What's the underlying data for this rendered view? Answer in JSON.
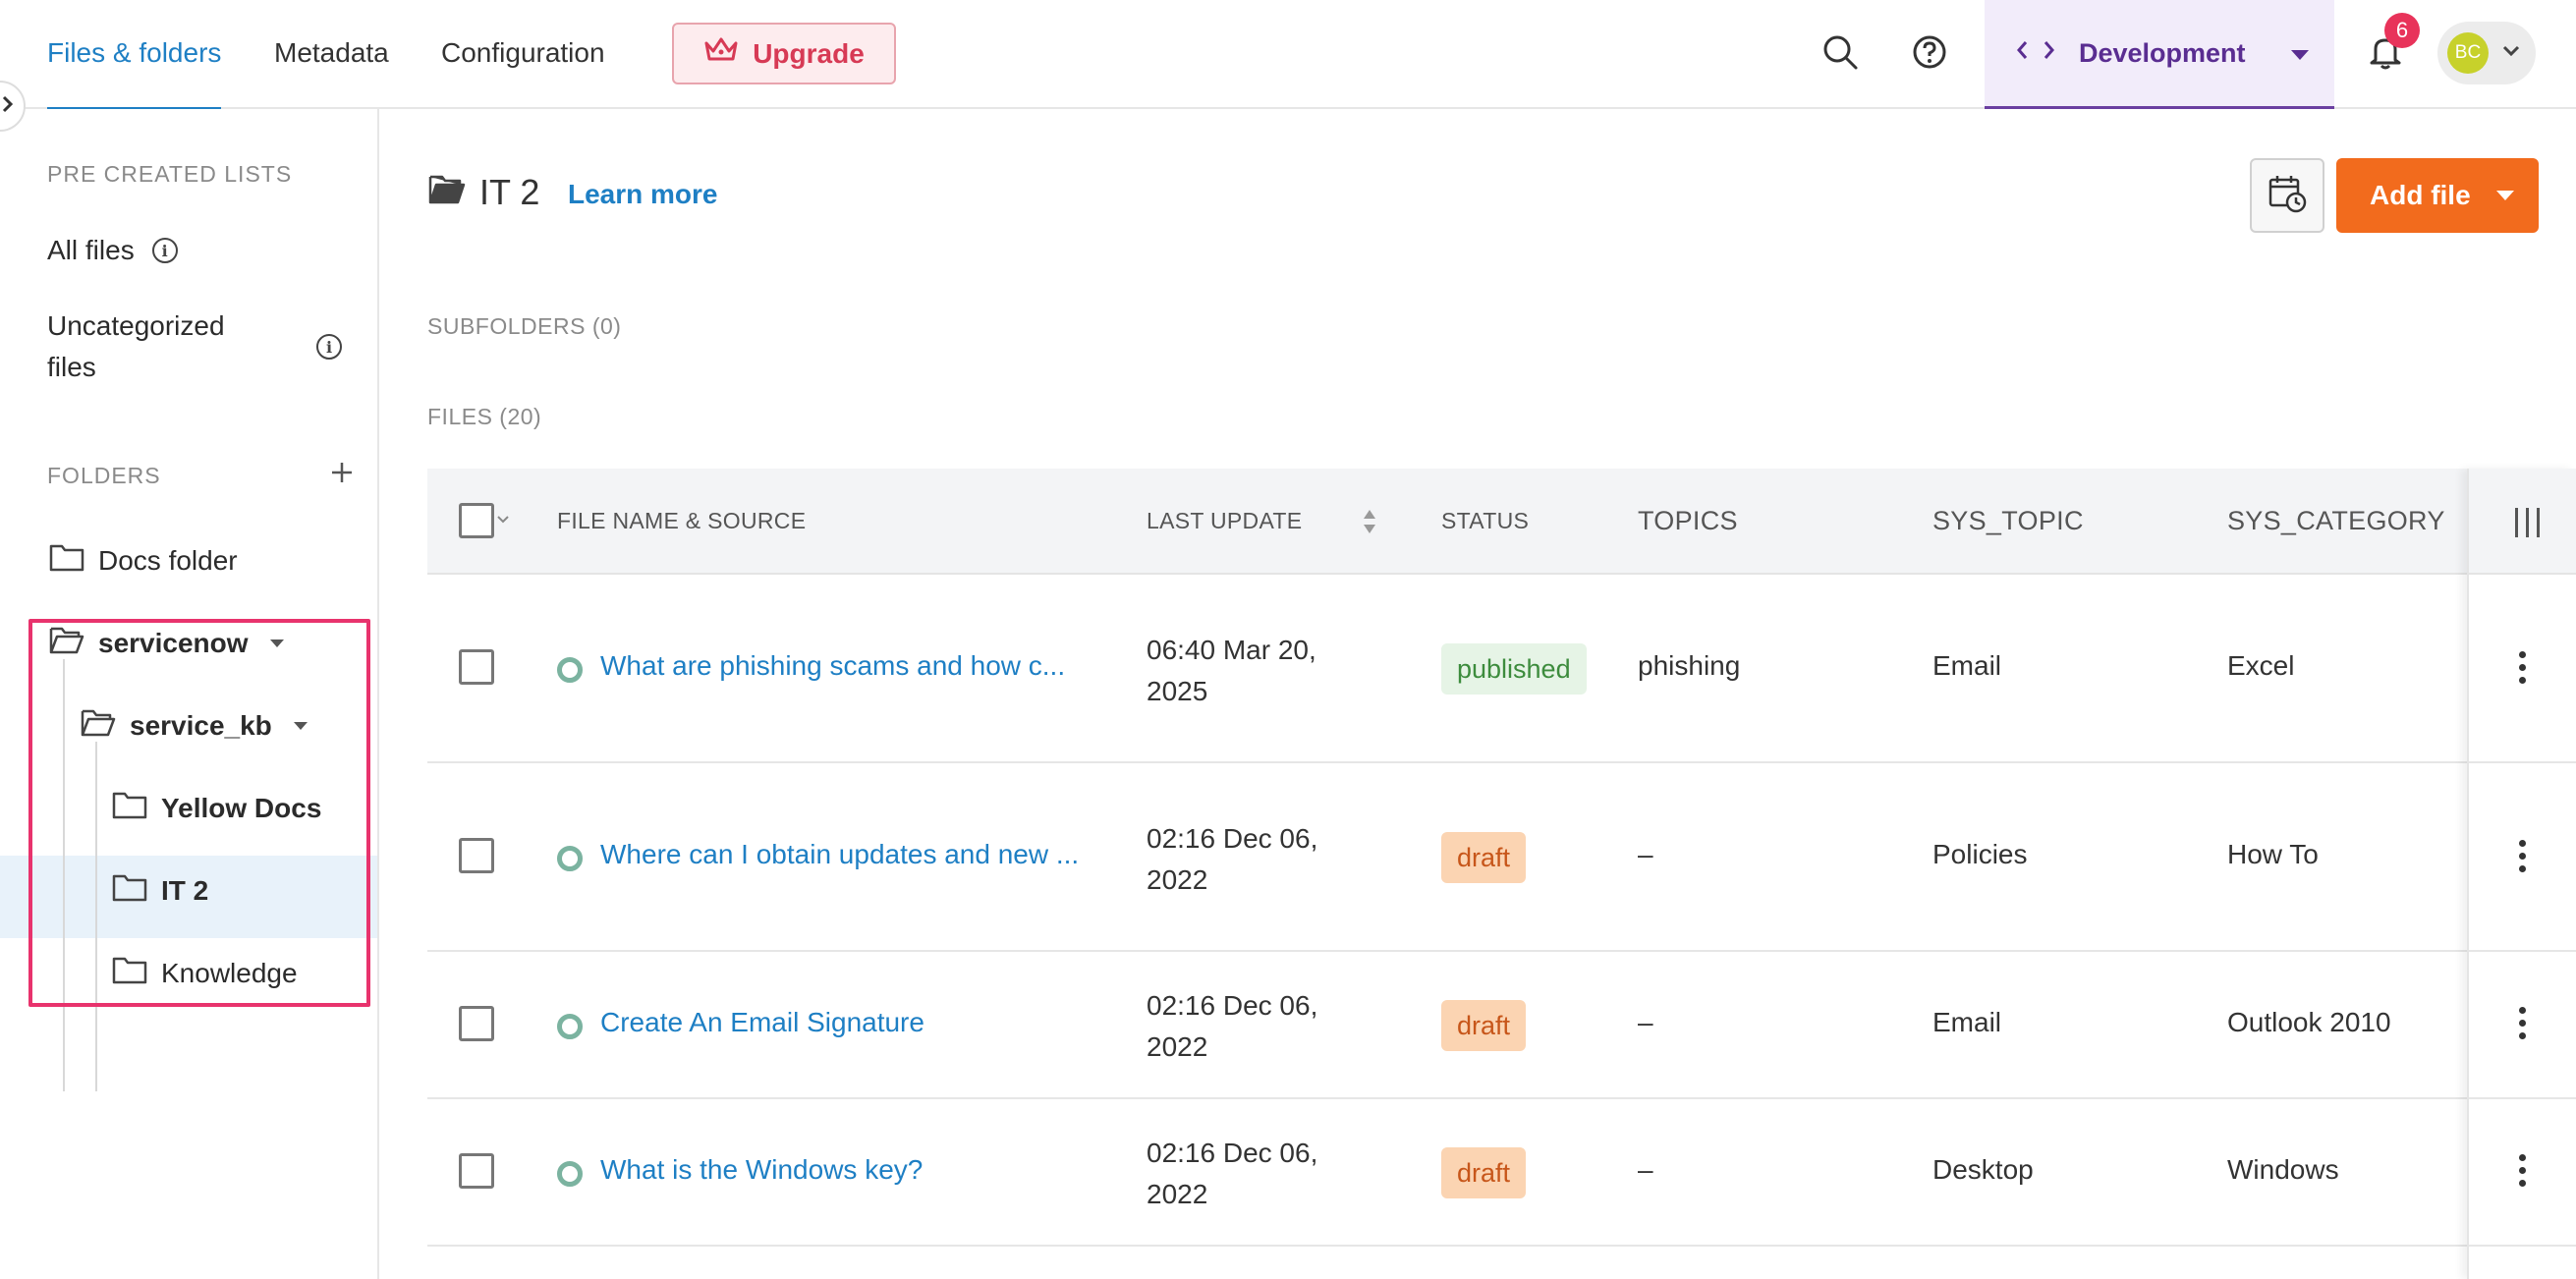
{
  "nav": {
    "tabs": [
      {
        "label": "Files & folders",
        "active": true
      },
      {
        "label": "Metadata",
        "active": false
      },
      {
        "label": "Configuration",
        "active": false
      }
    ],
    "upgrade_label": "Upgrade",
    "environment_label": "Development",
    "notification_count": "6",
    "avatar_initials": "BC"
  },
  "sidebar": {
    "precreated_heading": "PRE CREATED LISTS",
    "all_files_label": "All files",
    "uncategorized_line1": "Uncategorized",
    "uncategorized_line2": "files",
    "folders_heading": "FOLDERS",
    "folders": {
      "docs_folder": "Docs folder",
      "servicenow": "servicenow",
      "service_kb": "service_kb",
      "yellow_docs": "Yellow Docs",
      "it2": "IT 2",
      "knowledge": "Knowledge"
    }
  },
  "main": {
    "folder_title": "IT 2",
    "learn_more": "Learn more",
    "add_file_label": "Add file",
    "subfolders_label": "SUBFOLDERS (0)",
    "files_label": "FILES (20)",
    "columns": {
      "file_name": "FILE NAME & SOURCE",
      "last_update": "LAST UPDATE",
      "status": "STATUS",
      "topics": "TOPICS",
      "sys_topic": "SYS_TOPIC",
      "sys_category": "SYS_CATEGORY"
    },
    "rows": [
      {
        "name": "What are phishing scams and how c...",
        "date_line1": "06:40 Mar 20,",
        "date_line2": "2025",
        "status": "published",
        "topics": "phishing",
        "sys_topic": "Email",
        "sys_category": "Excel"
      },
      {
        "name": "Where can I obtain updates and new ...",
        "date_line1": "02:16 Dec 06,",
        "date_line2": "2022",
        "status": "draft",
        "topics": "–",
        "sys_topic": "Policies",
        "sys_category": "How To"
      },
      {
        "name": "Create An Email Signature",
        "date_line1": "02:16 Dec 06,",
        "date_line2": "2022",
        "status": "draft",
        "topics": "–",
        "sys_topic": "Email",
        "sys_category": "Outlook 2010"
      },
      {
        "name": "What is the Windows key?",
        "date_line1": "02:16 Dec 06,",
        "date_line2": "2022",
        "status": "draft",
        "topics": "–",
        "sys_topic": "Desktop",
        "sys_category": "Windows"
      }
    ]
  },
  "colors": {
    "accent_blue": "#1e7fc4",
    "add_orange": "#f26b1d",
    "env_purple": "#5a2d91",
    "highlight_pink": "#e8336d"
  }
}
